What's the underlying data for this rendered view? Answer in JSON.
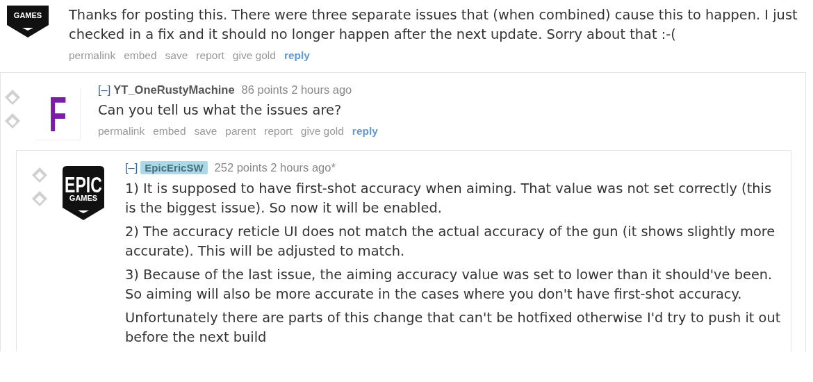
{
  "comments": [
    {
      "avatar": {
        "kind": "epic",
        "texts": [
          "GAMES"
        ]
      },
      "body": [
        "Thanks for posting this. There were three separate issues that (when combined) cause this to happen. I just checked in a fix and it should no longer happen after the next update. Sorry about that :-("
      ],
      "actions": [
        {
          "label": "permalink",
          "kind": "link"
        },
        {
          "label": "embed",
          "kind": "link"
        },
        {
          "label": "save",
          "kind": "link"
        },
        {
          "label": "report",
          "kind": "link"
        },
        {
          "label": "give gold",
          "kind": "link"
        },
        {
          "label": "reply",
          "kind": "reply"
        }
      ],
      "children": [
        {
          "collapse": "[–]",
          "author": "YT_OneRustyMachine",
          "highlighted": false,
          "meta": "86 points 2 hours ago",
          "avatar": {
            "kind": "letter",
            "texts": [
              "F"
            ]
          },
          "body": [
            "Can you tell us what the issues are?"
          ],
          "actions": [
            {
              "label": "permalink",
              "kind": "link"
            },
            {
              "label": "embed",
              "kind": "link"
            },
            {
              "label": "save",
              "kind": "link"
            },
            {
              "label": "parent",
              "kind": "link"
            },
            {
              "label": "report",
              "kind": "link"
            },
            {
              "label": "give gold",
              "kind": "link"
            },
            {
              "label": "reply",
              "kind": "reply"
            }
          ],
          "children": [
            {
              "collapse": "[–]",
              "author": "EpicEricSW",
              "highlighted": true,
              "meta": "252 points 2 hours ago*",
              "avatar": {
                "kind": "epic",
                "texts": [
                  "EPIC",
                  "GAMES"
                ]
              },
              "body": [
                "1) It is supposed to have first-shot accuracy when aiming. That value was not set correctly (this is the biggest issue). So now it will be enabled.",
                "2) The accuracy reticle UI does not match the actual accuracy of the gun (it shows slightly more accurate). This will be adjusted to match.",
                "3) Because of the last issue, the aiming accuracy value was set to lower than it should've been. So aiming will also be more accurate in the cases where you don't have first-shot accuracy.",
                "Unfortunately there are parts of this change that can't be hotfixed otherwise I'd try to push it out before the next build"
              ]
            }
          ]
        }
      ]
    }
  ]
}
